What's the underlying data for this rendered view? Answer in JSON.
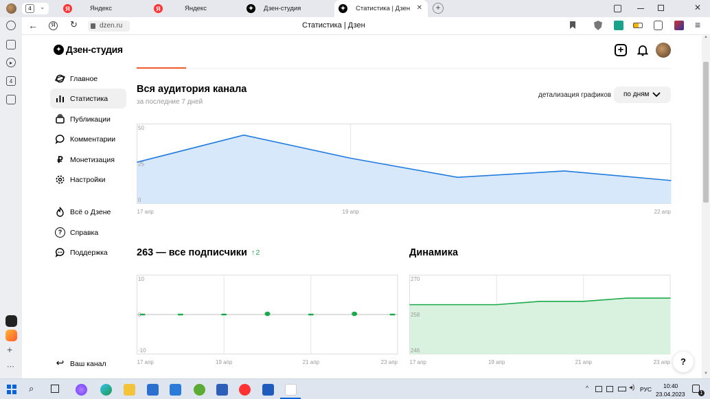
{
  "browser": {
    "tab_count": "4",
    "tabs": [
      {
        "label": "Яндекс"
      },
      {
        "label": "Яндекс"
      },
      {
        "label": "Дзен-студия"
      },
      {
        "label": "Статистика | Дзен"
      }
    ],
    "url": "dzen.ru",
    "page_title": "Статистика | Дзен"
  },
  "studio": {
    "logo": "Дзен-студия",
    "nav": [
      {
        "label": "Главное"
      },
      {
        "label": "Статистика"
      },
      {
        "label": "Публикации"
      },
      {
        "label": "Комментарии"
      },
      {
        "label": "Монетизация"
      },
      {
        "label": "Настройки"
      },
      {
        "label": "Всё о Дзене"
      },
      {
        "label": "Справка"
      },
      {
        "label": "Поддержка"
      }
    ],
    "your_channel": "Ваш канал",
    "help_glyph": "?"
  },
  "audience": {
    "title": "Вся аудитория канала",
    "subtitle": "за последние 7 дней",
    "detail_label": "детализация графиков",
    "detail_value": "по дням"
  },
  "subscribers": {
    "title": "263 — все подписчики",
    "delta": "2"
  },
  "dynamics": {
    "title": "Динамика"
  },
  "chart_data": [
    {
      "type": "area",
      "x": [
        "17 апр",
        "18 апр",
        "19 апр",
        "20 апр",
        "21 апр",
        "22 апр"
      ],
      "x_tick_labels": [
        "17 апр",
        "19 апр",
        "22 апр"
      ],
      "values": [
        26,
        43,
        28.5,
        16.5,
        20.5,
        14.5
      ],
      "yticks": [
        "50",
        "25",
        "0"
      ],
      "ylim": [
        0,
        50
      ],
      "color": "#1f7ae0",
      "fill": "#d8e8fb"
    },
    {
      "type": "scatter",
      "x": [
        "17 апр",
        "18 апр",
        "19 апр",
        "20 апр",
        "21 апр",
        "22 апр",
        "23 апр"
      ],
      "x_tick_labels": [
        "17 апр",
        "19 апр",
        "21 апр",
        "23 апр"
      ],
      "values": [
        0,
        0,
        0,
        1,
        0,
        1,
        0
      ],
      "yticks": [
        "10",
        "0",
        "-10"
      ],
      "ylim": [
        -10,
        10
      ],
      "color": "#1aaa4b"
    },
    {
      "type": "area",
      "x": [
        "17 апр",
        "18 апр",
        "19 апр",
        "20 апр",
        "21 апр",
        "22 апр",
        "23 апр"
      ],
      "x_tick_labels": [
        "17 апр",
        "19 апр",
        "21 апр",
        "23 апр"
      ],
      "values": [
        261,
        261,
        261,
        262,
        262,
        263,
        263
      ],
      "yticks": [
        "270",
        "258",
        "246"
      ],
      "ylim": [
        246,
        270
      ],
      "color": "#1aaa4b",
      "fill": "#d9f2df"
    }
  ],
  "taskbar": {
    "lang": "РУС",
    "time": "10:40",
    "date": "23.04.2023",
    "notif_count": "1"
  }
}
